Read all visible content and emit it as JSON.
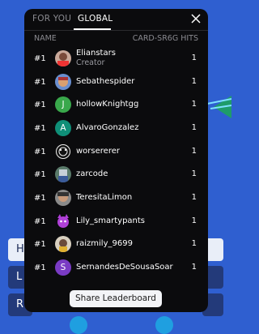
{
  "background": {
    "left_buttons": [
      "H",
      "L",
      "R"
    ]
  },
  "modal": {
    "tabs": [
      {
        "label": "FOR YOU"
      },
      {
        "label": "GLOBAL"
      }
    ],
    "columns": {
      "name": "NAME",
      "hits": "CARD-SR6G HITS"
    },
    "rows": [
      {
        "rank": "#1",
        "name": "Elianstars",
        "sub": "Creator",
        "hits": "1",
        "avatar": "photo"
      },
      {
        "rank": "#1",
        "name": "Sebathespider",
        "hits": "1",
        "avatar": "photo"
      },
      {
        "rank": "#1",
        "name": "hollowKnightgg",
        "hits": "1",
        "avatar": "letter",
        "letter": "J",
        "color": "#39a84b"
      },
      {
        "rank": "#1",
        "name": "AlvaroGonzalez",
        "hits": "1",
        "avatar": "letter",
        "letter": "A",
        "color": "#0f8f78"
      },
      {
        "rank": "#1",
        "name": "worsererer",
        "hits": "1",
        "avatar": "pattern"
      },
      {
        "rank": "#1",
        "name": "zarcode",
        "hits": "1",
        "avatar": "photo"
      },
      {
        "rank": "#1",
        "name": "TeresitaLimon",
        "hits": "1",
        "avatar": "photo"
      },
      {
        "rank": "#1",
        "name": "Lily_smartypants",
        "hits": "1",
        "avatar": "character"
      },
      {
        "rank": "#1",
        "name": "raizmily_9699",
        "hits": "1",
        "avatar": "photo"
      },
      {
        "rank": "#1",
        "name": "SernandesDeSousaSoar",
        "hits": "1",
        "avatar": "letter",
        "letter": "S",
        "color": "#7a3bc4"
      }
    ],
    "share_label": "Share Leaderboard"
  }
}
